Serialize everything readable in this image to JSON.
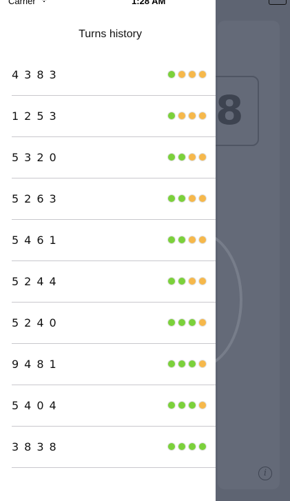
{
  "status_bar": {
    "carrier": "Carrier",
    "time": "1:28 AM"
  },
  "drawer": {
    "title": "Turns history",
    "turns": [
      {
        "digits": "4383",
        "dots": [
          "green",
          "orange",
          "orange",
          "orange"
        ]
      },
      {
        "digits": "1253",
        "dots": [
          "green",
          "orange",
          "orange",
          "orange"
        ]
      },
      {
        "digits": "5320",
        "dots": [
          "green",
          "green",
          "orange",
          "orange"
        ]
      },
      {
        "digits": "5263",
        "dots": [
          "green",
          "green",
          "orange",
          "orange"
        ]
      },
      {
        "digits": "5461",
        "dots": [
          "green",
          "green",
          "orange",
          "orange"
        ]
      },
      {
        "digits": "5244",
        "dots": [
          "green",
          "green",
          "orange",
          "orange"
        ]
      },
      {
        "digits": "5240",
        "dots": [
          "green",
          "green",
          "green",
          "orange"
        ]
      },
      {
        "digits": "9481",
        "dots": [
          "green",
          "green",
          "green",
          "orange"
        ]
      },
      {
        "digits": "5404",
        "dots": [
          "green",
          "green",
          "green",
          "orange"
        ]
      },
      {
        "digits": "3838",
        "dots": [
          "green",
          "green",
          "green",
          "green"
        ]
      }
    ]
  },
  "background": {
    "number": "8",
    "info_icon": "info-icon"
  },
  "colors": {
    "green": "#7bd13b",
    "orange": "#f6b84b"
  }
}
